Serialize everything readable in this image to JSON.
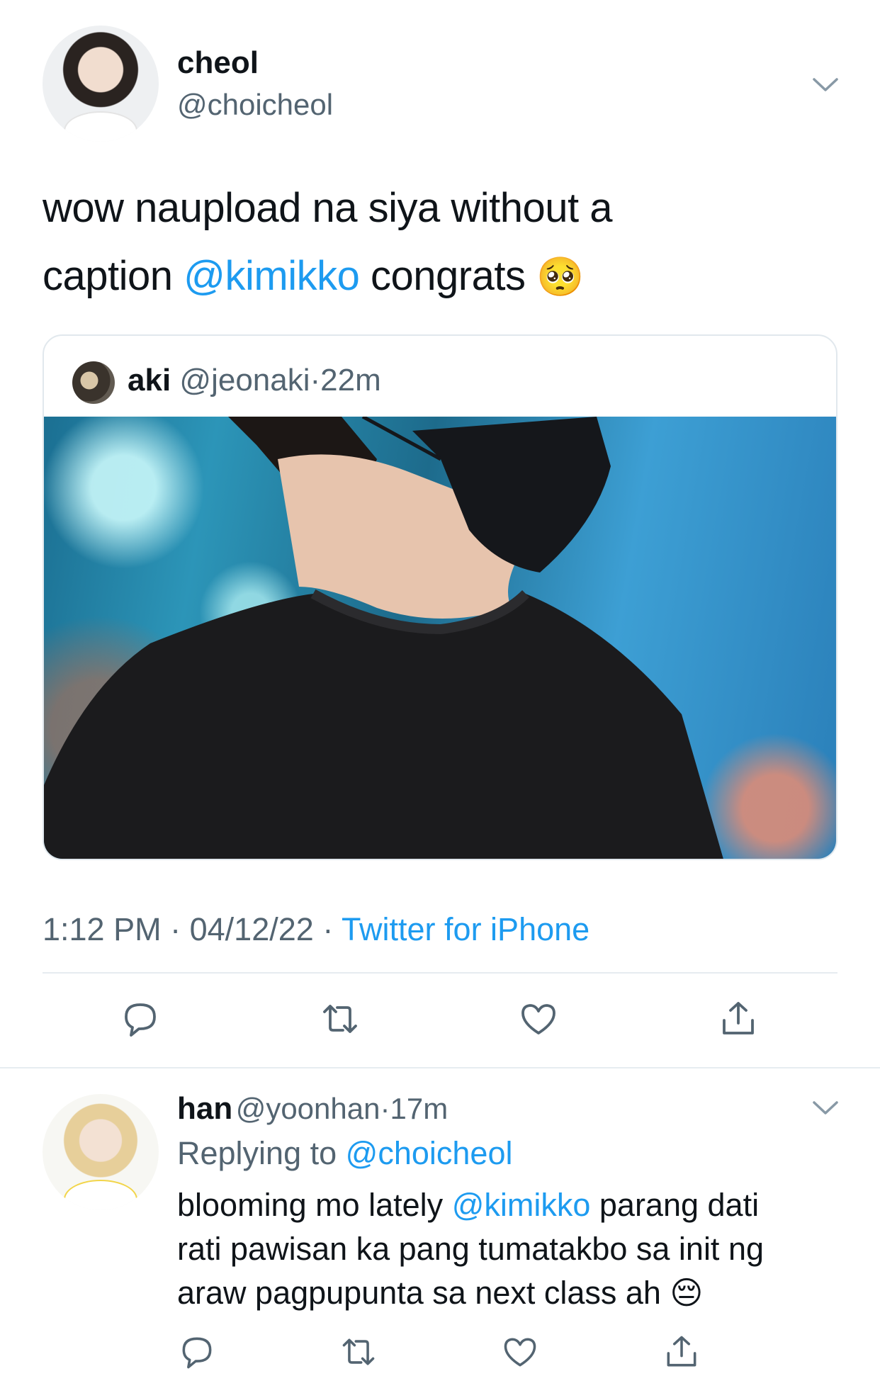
{
  "tweet": {
    "author_name": "cheol",
    "author_handle": "@choicheol",
    "text_line1": "wow naupload na siya without a",
    "text_line2_before": "caption ",
    "text_mention": "@kimikko",
    "text_line2_after": " congrats",
    "text_emoji": "🥺",
    "quoted": {
      "author_name": "aki",
      "author_handle": "@jeonaki",
      "separator": "·",
      "time": "22m"
    },
    "time": "1:12 PM",
    "separator": "·",
    "date": "04/12/22",
    "source": "Twitter for iPhone"
  },
  "reply": {
    "author_name": "han",
    "author_handle": "@yoonhan",
    "separator": "·",
    "time": "17m",
    "replying_to_label": "Replying to",
    "replying_to_handle": "@choicheol",
    "line1_before": "blooming mo lately ",
    "line1_mention": "@kimikko",
    "line1_after": " parang dati",
    "line2": "rati pawisan ka pang tumatakbo sa init ng",
    "line3": "araw pagpupunta sa next class ah",
    "emoji": "😔"
  },
  "icons": [
    "chevron-down-icon",
    "reply-icon",
    "retweet-icon",
    "like-icon",
    "share-icon"
  ],
  "colors": {
    "text": "#0f1419",
    "muted": "#536471",
    "link": "#1d9bf0",
    "divider": "#e6ecf0"
  }
}
